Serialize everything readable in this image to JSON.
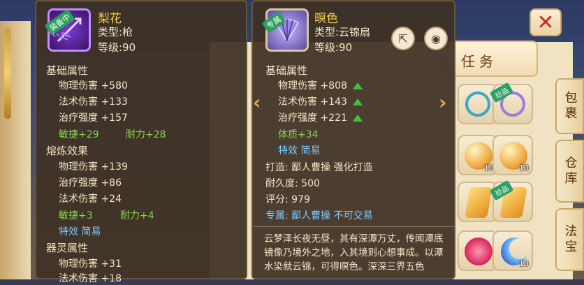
{
  "left_item": {
    "badge": "装备中",
    "icon_level": "Lv.90",
    "name": "梨花",
    "type": "类型:枪",
    "level": "等级:90",
    "base_title": "基础属性",
    "base_stats": [
      "物理伤害 +580",
      "法术伤害 +133",
      "治疗强度 +157"
    ],
    "base_bonus": [
      "敏捷+29",
      "耐力+28"
    ],
    "forge_title": "熔炼效果",
    "forge_stats": [
      "物理伤害 +139",
      "治疗强度 +86",
      "法术伤害 +24"
    ],
    "forge_bonus": [
      "敏捷+3",
      "耐力+4"
    ],
    "forge_special": "特效  简易",
    "spirit_title": "器灵属性",
    "spirit_stats": [
      "物理伤害 +31",
      "法术伤害 +18"
    ]
  },
  "right_item": {
    "badge": "专属",
    "name": "暝色",
    "type": "类型:云锦扇",
    "level": "等级:90",
    "base_title": "基础属性",
    "base_stats": [
      "物理伤害 +808",
      "法术伤害 +143",
      "治疗强度 +221"
    ],
    "bonus": "体质+34",
    "special": "特效  简易",
    "forge": "打造:  鄙人曹操    强化打造",
    "durability": "耐久度:  500",
    "score": "评分:  979",
    "exclusive": "专属:  鄙人曹操  不可交易",
    "description": "云梦泽长夜无昼，其有深潭万丈，传闻潭底镜像乃境外之地，入其境则心想事成。以潭水染就云锦，可得暝色。深深三界五色"
  },
  "ui": {
    "task_tab": "任务",
    "side_tabs": [
      "包裹",
      "仓库",
      "法宝"
    ],
    "rare_tag": "珍品",
    "slot_qty": "10"
  },
  "colors": {
    "gold_name": "#f2c94c",
    "green_bonus": "#86d34a",
    "blue_info": "#7ec8ff",
    "arrow": "#3fc23a"
  }
}
